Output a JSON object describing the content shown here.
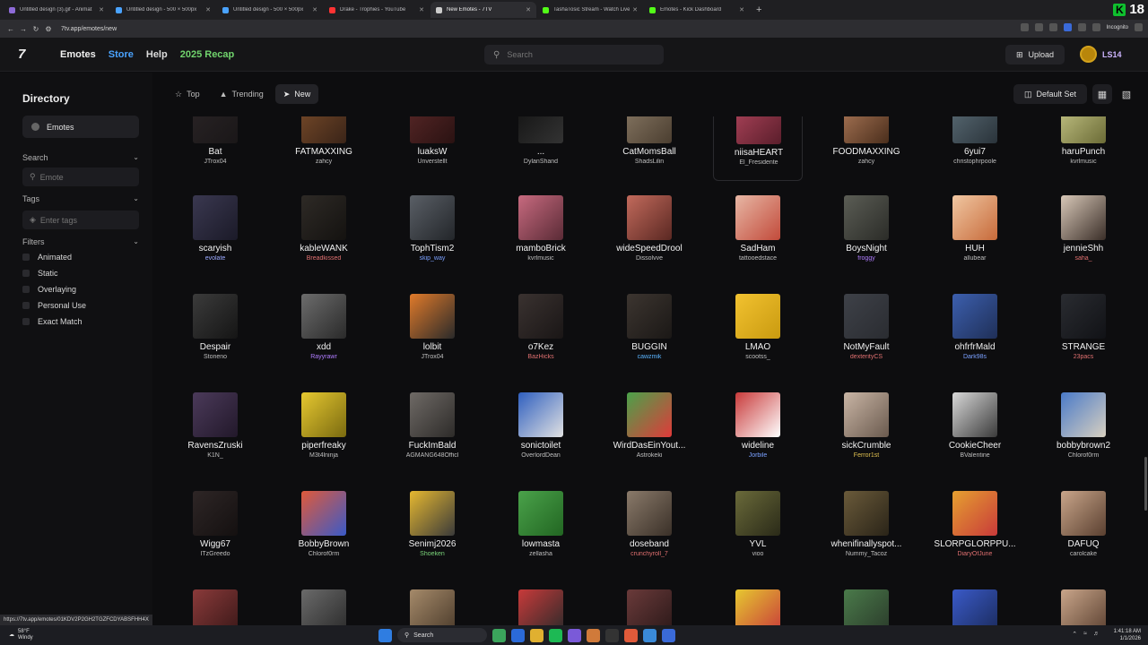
{
  "browser": {
    "tabs": [
      {
        "label": "Untitled design (3).gif - Animat",
        "color": "#8e6bd8",
        "active": false
      },
      {
        "label": "Untitled design - 500 × 500px",
        "color": "#4aa3ff",
        "active": false
      },
      {
        "label": "Untitled design - 500 × 500px",
        "color": "#4aa3ff",
        "active": false
      },
      {
        "label": "Drake - Trophies - YouTube",
        "color": "#ff3333",
        "active": false
      },
      {
        "label": "New Emotes - 7TV",
        "color": "#cccccc",
        "active": true
      },
      {
        "label": "TashaTosic Stream - Watch Live",
        "color": "#53fc18",
        "active": false
      },
      {
        "label": "Emotes - Kick Dashboard",
        "color": "#53fc18",
        "active": false
      }
    ],
    "new_tab": "+",
    "url": "7tv.app/emotes/new",
    "incognito_label": "Incognito",
    "kick_badge": "K",
    "kick_count": "18",
    "status_url": "https://7tv.app/emotes/01KDV2P2GH2TGZFCDYABSFHH4X"
  },
  "header": {
    "logo": "7",
    "nav": {
      "emotes": "Emotes",
      "store": "Store",
      "help": "Help",
      "recap": "2025 Recap"
    },
    "search_placeholder": "Search",
    "upload": "Upload",
    "username": "LS14"
  },
  "sidebar": {
    "title": "Directory",
    "emotes": "Emotes",
    "search_label": "Search",
    "search_placeholder": "Emote",
    "tags_label": "Tags",
    "tags_placeholder": "Enter tags",
    "filters_label": "Filters",
    "filters": [
      "Animated",
      "Static",
      "Overlaying",
      "Personal Use",
      "Exact Match"
    ]
  },
  "toolbar": {
    "top": "Top",
    "trending": "Trending",
    "new": "New",
    "default_set": "Default Set"
  },
  "emotes": [
    {
      "name": "Bat",
      "owner": "JTrox04",
      "oc": "#bfbfbf",
      "c1": "#2a2426",
      "c2": "#1a1718"
    },
    {
      "name": "FATMAXXING",
      "owner": "zahcy",
      "oc": "#bfbfbf",
      "c1": "#7a4c2a",
      "c2": "#3a2418"
    },
    {
      "name": "luaksW",
      "owner": "Unverstellt",
      "oc": "#bfbfbf",
      "c1": "#5a2828",
      "c2": "#2a1212"
    },
    {
      "name": "...",
      "owner": "DylanShand",
      "oc": "#bfbfbf",
      "c1": "#111111",
      "c2": "#333333"
    },
    {
      "name": "CatMomsBall",
      "owner": "ShadsLilin",
      "oc": "#bfbfbf",
      "c1": "#8a7a66",
      "c2": "#4b3e30"
    },
    {
      "name": "niisaHEART",
      "owner": "El_Fresidente",
      "oc": "#bfbfbf",
      "c1": "#b0455c",
      "c2": "#5a1e2b"
    },
    {
      "name": "FOODMAXXING",
      "owner": "zahcy",
      "oc": "#bfbfbf",
      "c1": "#b07b5a",
      "c2": "#4a2e1c"
    },
    {
      "name": "6yui7",
      "owner": "christophrpoole",
      "oc": "#bfbfbf",
      "c1": "#5c6e78",
      "c2": "#2a333a"
    },
    {
      "name": "haruPunch",
      "owner": "kvrlmusic",
      "oc": "#bfbfbf",
      "c1": "#c9c98a",
      "c2": "#6b6b36"
    },
    {
      "name": "scaryish",
      "owner": "evolate",
      "oc": "#9aa9ff",
      "c1": "#3a3850",
      "c2": "#1b1a28"
    },
    {
      "name": "kableWANK",
      "owner": "Breadkissed",
      "oc": "#e07070",
      "c1": "#2e2a26",
      "c2": "#141210"
    },
    {
      "name": "TophTism2",
      "owner": "skip_way",
      "oc": "#7aa0ff",
      "c1": "#5a5f66",
      "c2": "#23262a"
    },
    {
      "name": "mamboBrick",
      "owner": "kvrlmusic",
      "oc": "#bfbfbf",
      "c1": "#c76a7f",
      "c2": "#5a2b36"
    },
    {
      "name": "wideSpeedDrool",
      "owner": "Dissolvve",
      "oc": "#bfbfbf",
      "c1": "#c26a5c",
      "c2": "#5a2822"
    },
    {
      "name": "SadHam",
      "owner": "tattooedstace",
      "oc": "#bfbfbf",
      "c1": "#e7b7a5",
      "c2": "#c24a3a"
    },
    {
      "name": "BoysNight",
      "owner": "froggy",
      "oc": "#b07cff",
      "c1": "#5b5d55",
      "c2": "#2b2c28"
    },
    {
      "name": "HUH",
      "owner": "allubear",
      "oc": "#bfbfbf",
      "c1": "#f0c7a2",
      "c2": "#c76a3a"
    },
    {
      "name": "jennieShh",
      "owner": "saha_",
      "oc": "#e07070",
      "c1": "#d8c8b8",
      "c2": "#3a2e28"
    },
    {
      "name": "Despair",
      "owner": "Stoneno",
      "oc": "#bfbfbf",
      "c1": "#3b3b3b",
      "c2": "#151515"
    },
    {
      "name": "xdd",
      "owner": "Rayyrawr",
      "oc": "#b07cff",
      "c1": "#6c6c6c",
      "c2": "#2a2a2a"
    },
    {
      "name": "lolbit",
      "owner": "JTrox04",
      "oc": "#bfbfbf",
      "c1": "#e07a2a",
      "c2": "#2a2a2a"
    },
    {
      "name": "o7Kez",
      "owner": "BazHicks",
      "oc": "#e07070",
      "c1": "#3a3230",
      "c2": "#1a1616"
    },
    {
      "name": "BUGGIN",
      "owner": "cawzmik",
      "oc": "#5ab4ff",
      "c1": "#3c3530",
      "c2": "#1b1816"
    },
    {
      "name": "LMAO",
      "owner": "scootss_",
      "oc": "#bfbfbf",
      "c1": "#f2c230",
      "c2": "#c99a10"
    },
    {
      "name": "NotMyFault",
      "owner": "dexterityCS",
      "oc": "#e07070",
      "c1": "#3e4148",
      "c2": "#2a2c31"
    },
    {
      "name": "ohfrfrMald",
      "owner": "Dark98s",
      "oc": "#7aa0ff",
      "c1": "#3c5fae",
      "c2": "#1f2f57"
    },
    {
      "name": "STRANGE",
      "owner": "23pacs",
      "oc": "#e07070",
      "c1": "#2a2c31",
      "c2": "#111216"
    },
    {
      "name": "RavensZruski",
      "owner": "K1N_",
      "oc": "#bfbfbf",
      "c1": "#4b3a5a",
      "c2": "#22182a"
    },
    {
      "name": "piperfreaky",
      "owner": "M3t4lninja",
      "oc": "#bfbfbf",
      "c1": "#e6c830",
      "c2": "#7a6a10"
    },
    {
      "name": "FuckImBald",
      "owner": "AGMANG648Officl",
      "oc": "#bfbfbf",
      "c1": "#6f6a66",
      "c2": "#2d2b29"
    },
    {
      "name": "sonictoilet",
      "owner": "OverlordDean",
      "oc": "#bfbfbf",
      "c1": "#2f5fbf",
      "c2": "#e2e2e2"
    },
    {
      "name": "WirdDasEinYout...",
      "owner": "Astrokeki",
      "oc": "#bfbfbf",
      "c1": "#4aa24a",
      "c2": "#e03a3a"
    },
    {
      "name": "wideline",
      "owner": "Jorbile",
      "oc": "#7aa0ff",
      "c1": "#c83a3a",
      "c2": "#ffffff"
    },
    {
      "name": "sickCrumble",
      "owner": "Ferror1st",
      "oc": "#e0c050",
      "c1": "#c9b5a5",
      "c2": "#6a5a4e"
    },
    {
      "name": "CookieCheer",
      "owner": "BValentine",
      "oc": "#bfbfbf",
      "c1": "#d8d8d8",
      "c2": "#3a3a3a"
    },
    {
      "name": "bobbybrown2",
      "owner": "Chlorof0rm",
      "oc": "#bfbfbf",
      "c1": "#4a7ac8",
      "c2": "#d8d0c0"
    },
    {
      "name": "Wigg67",
      "owner": "ITzGreedo",
      "oc": "#bfbfbf",
      "c1": "#2e2626",
      "c2": "#141010"
    },
    {
      "name": "BobbyBrown",
      "owner": "Chlorof0rm",
      "oc": "#bfbfbf",
      "c1": "#e05a3a",
      "c2": "#3a5ac8"
    },
    {
      "name": "Senimj2026",
      "owner": "Shoeken",
      "oc": "#7ad47a",
      "c1": "#e6b830",
      "c2": "#3a3a3a"
    },
    {
      "name": "lowmasta",
      "owner": "zellasha",
      "oc": "#bfbfbf",
      "c1": "#4aa24a",
      "c2": "#226622"
    },
    {
      "name": "doseband",
      "owner": "crunchyroll_7",
      "oc": "#e07070",
      "c1": "#8a7a6a",
      "c2": "#3a3028"
    },
    {
      "name": "YVL",
      "owner": "vioo",
      "oc": "#bfbfbf",
      "c1": "#6a6a3a",
      "c2": "#2a2a18"
    },
    {
      "name": "whenifinallyspot...",
      "owner": "Nummy_Tacoz",
      "oc": "#bfbfbf",
      "c1": "#6a5a3a",
      "c2": "#2a2418"
    },
    {
      "name": "SLORPGLORPPU...",
      "owner": "DiaryOfJune",
      "oc": "#e07070",
      "c1": "#e6a030",
      "c2": "#c83a3a"
    },
    {
      "name": "DAFUQ",
      "owner": "carolcake",
      "oc": "#bfbfbf",
      "c1": "#c9a58a",
      "c2": "#5a4030"
    },
    {
      "name": "",
      "owner": "",
      "oc": "#bfbfbf",
      "c1": "#8a3a3a",
      "c2": "#3a1818"
    },
    {
      "name": "",
      "owner": "",
      "oc": "#bfbfbf",
      "c1": "#6a6a6a",
      "c2": "#2a2a2a"
    },
    {
      "name": "",
      "owner": "",
      "oc": "#bfbfbf",
      "c1": "#a58a6a",
      "c2": "#4a3a2a"
    },
    {
      "name": "",
      "owner": "",
      "oc": "#bfbfbf",
      "c1": "#c83a3a",
      "c2": "#2a2a2a"
    },
    {
      "name": "",
      "owner": "",
      "oc": "#bfbfbf",
      "c1": "#6a3a3a",
      "c2": "#2a1818"
    },
    {
      "name": "",
      "owner": "",
      "oc": "#bfbfbf",
      "c1": "#e6c830",
      "c2": "#c83a3a"
    },
    {
      "name": "",
      "owner": "",
      "oc": "#bfbfbf",
      "c1": "#4a7a4a",
      "c2": "#2a3a2a"
    },
    {
      "name": "",
      "owner": "",
      "oc": "#bfbfbf",
      "c1": "#3a5ac8",
      "c2": "#1a2a5a"
    },
    {
      "name": "",
      "owner": "",
      "oc": "#bfbfbf",
      "c1": "#c9a58a",
      "c2": "#5a4030"
    }
  ],
  "taskbar": {
    "weather_temp": "58°F",
    "weather_desc": "Windy",
    "search": "Search",
    "time": "1:41:18 AM",
    "date": "1/1/2026"
  }
}
